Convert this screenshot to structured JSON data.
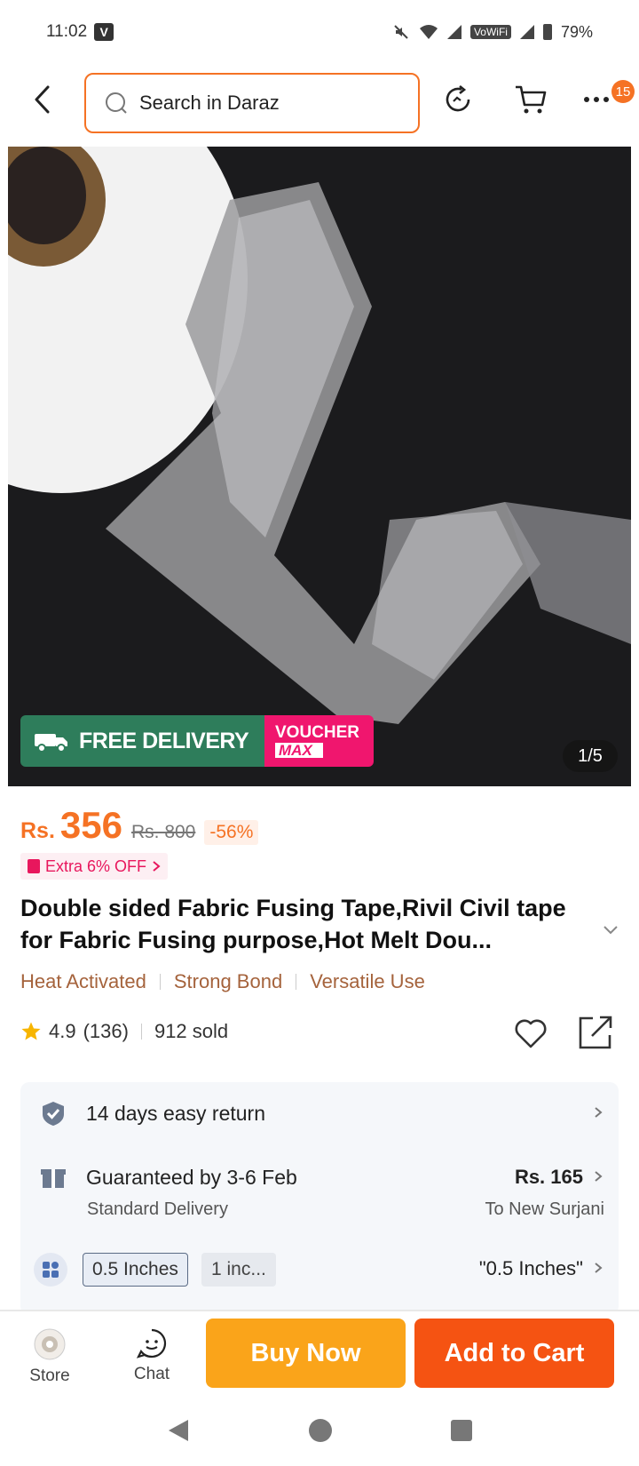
{
  "status_bar": {
    "time": "11:02",
    "carrier_badge": "V",
    "wifi_label": "VoWiFi",
    "battery": "79%"
  },
  "header": {
    "search_placeholder": "Search in Daraz",
    "more_badge": "15"
  },
  "gallery": {
    "banner_free_tag": "FREE",
    "banner_free_text": "FREE DELIVERY",
    "banner_voucher_line1": "VOUCHER",
    "banner_voucher_line2": "MAX",
    "pager": "1/5"
  },
  "price": {
    "currency": "Rs.",
    "current": "356",
    "original": "Rs. 800",
    "discount": "-56%",
    "extra_offer": "Extra 6% OFF"
  },
  "product": {
    "title": "Double sided Fabric Fusing Tape,Rivil Civil tape for Fabric Fusing purpose,Hot Melt Dou...",
    "features": [
      "Heat Activated",
      "Strong Bond",
      "Versatile Use"
    ],
    "rating": "4.9",
    "reviews": "(136)",
    "sold": "912 sold"
  },
  "info": {
    "return_text": "14 days easy return",
    "delivery_main": "Guaranteed by 3-6 Feb",
    "delivery_sub": "Standard Delivery",
    "delivery_price": "Rs. 165",
    "delivery_location": "To New Surjani",
    "variants": [
      "0.5 Inches",
      "1 inc..."
    ],
    "selected_variant": "\"0.5 Inches\""
  },
  "actions": {
    "store_label": "Store",
    "chat_label": "Chat",
    "buy_now": "Buy Now",
    "add_to_cart": "Add to Cart"
  },
  "colors": {
    "accent": "#f57224",
    "buy_now": "#faa41a",
    "add_to_cart": "#f55312",
    "feature_text": "#a5633c",
    "voucher_pink": "#f0166e",
    "free_delivery_green": "#2e7d5b"
  }
}
